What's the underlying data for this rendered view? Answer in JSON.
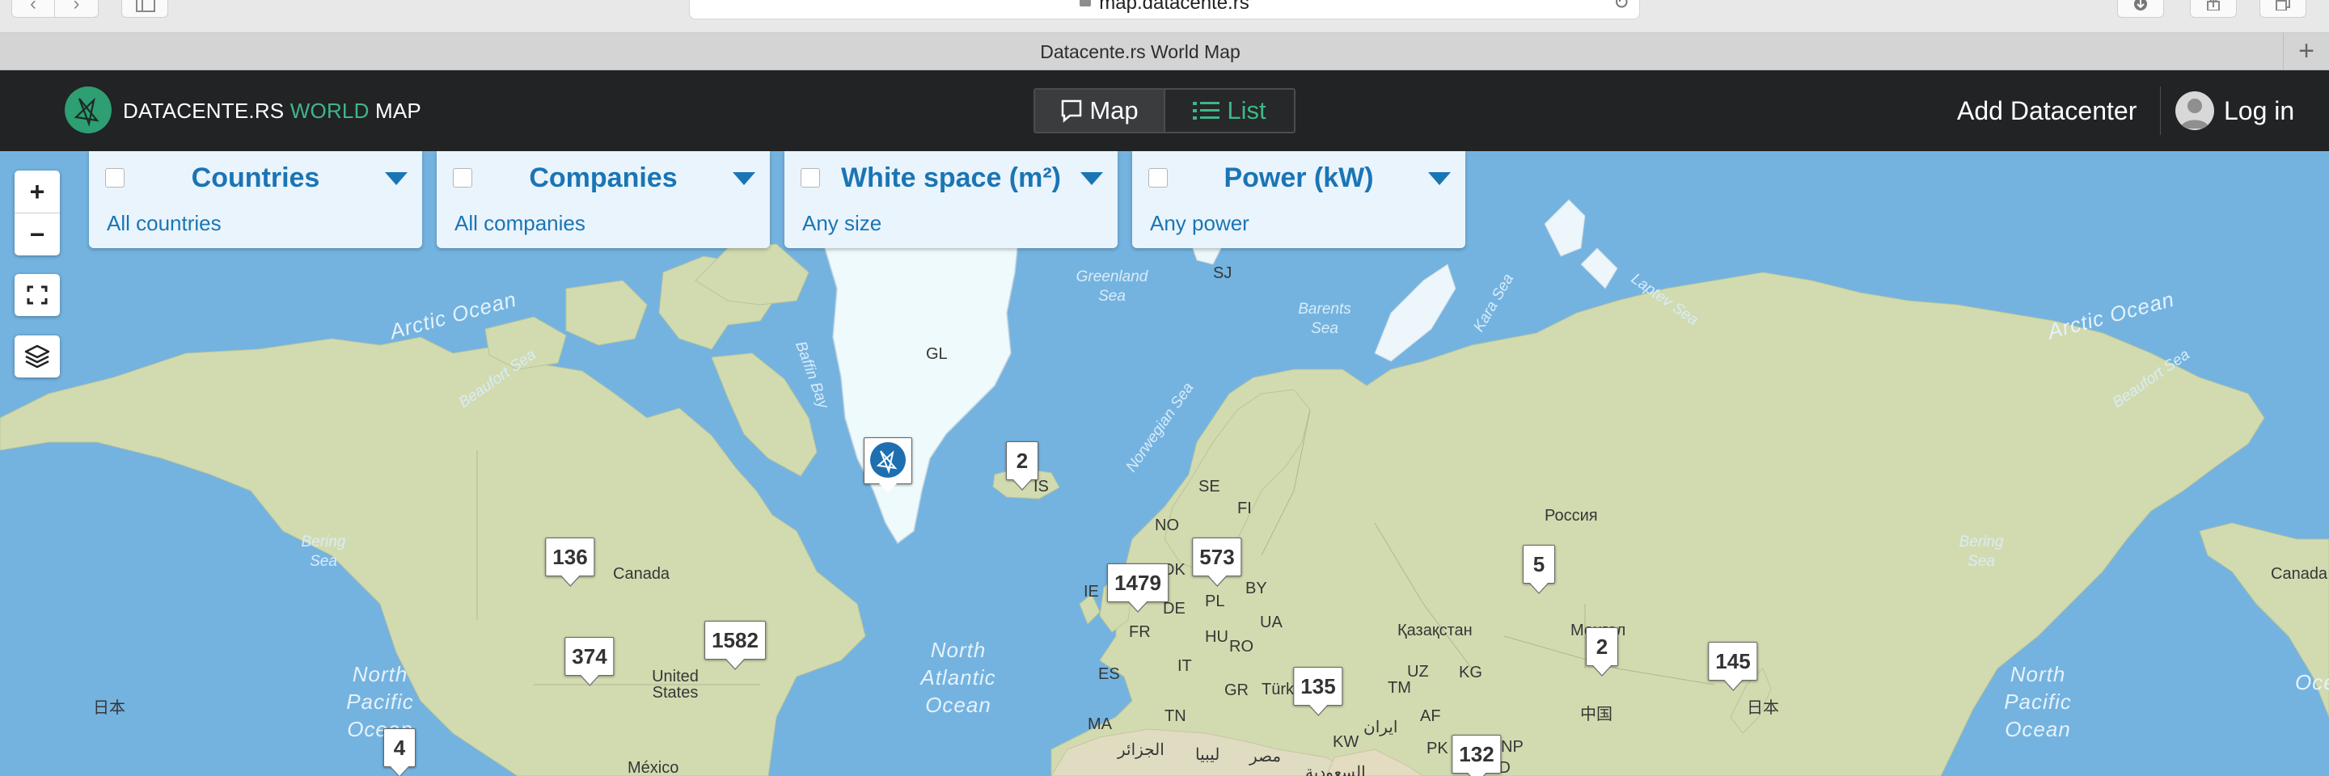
{
  "browser": {
    "address": "map.datacente.rs",
    "tab_title": "Datacente.rs World Map",
    "new_tab": "+"
  },
  "header": {
    "brand_prefix": "DATACENTE.RS",
    "brand_world": "WORLD",
    "brand_suffix": "MAP",
    "view_map": "Map",
    "view_list": "List",
    "add_datacenter": "Add Datacenter",
    "login": "Log in"
  },
  "controls": {
    "zoom_in": "+",
    "zoom_out": "−"
  },
  "filters": [
    {
      "title": "Countries",
      "value": "All countries"
    },
    {
      "title": "Companies",
      "value": "All companies"
    },
    {
      "title": "White space (m²)",
      "value": "Any size"
    },
    {
      "title": "Power (kW)",
      "value": "Any power"
    }
  ],
  "markers": [
    "2",
    "136",
    "374",
    "1582",
    "4",
    "1479",
    "573",
    "5",
    "2",
    "145",
    "135",
    "132"
  ],
  "labels": {
    "oceans": [
      "Arctic Ocean",
      "Arctic Ocean",
      "North Atlantic Ocean",
      "North Pacific Ocean",
      "North Pacific Ocean",
      "Ocean"
    ],
    "seas": [
      "Greenland Sea",
      "Barents Sea",
      "Beaufort Sea",
      "Beaufort Sea",
      "Baffin Bay",
      "Bering Sea",
      "Bering Sea",
      "Norwegian Sea",
      "Kara Sea",
      "Laptev Sea"
    ],
    "places": [
      "GL",
      "SJ",
      "Canada",
      "Canada",
      "United States",
      "México",
      "日本",
      "日本",
      "SE",
      "NO",
      "FI",
      "DK",
      "IE",
      "PL",
      "BY",
      "UA",
      "FR",
      "DE",
      "HU",
      "RO",
      "IT",
      "ES",
      "GR",
      "Türk",
      "MA",
      "TN",
      "الجزائر",
      "ليبيا",
      "مصر",
      "Россия",
      "Қазақстан",
      "Монгол",
      "UZ",
      "KG",
      "TM",
      "AF",
      "ایران",
      "KW",
      "PK",
      "NP",
      "BD",
      "中国",
      "السعودية",
      "IS"
    ]
  }
}
